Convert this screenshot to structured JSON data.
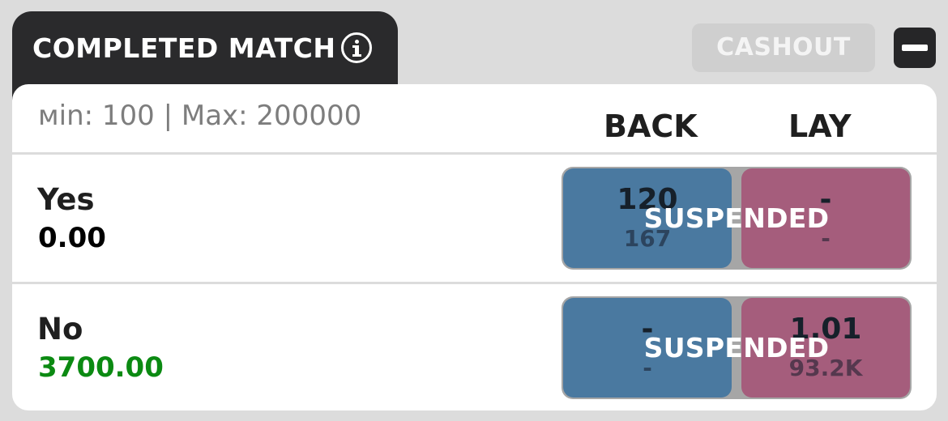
{
  "market": {
    "title": "COMPLETED MATCH",
    "info_icon": "info-icon",
    "cashout_label": "CASHOUT",
    "collapse_icon": "minus-icon",
    "limits": "мin: 100 | Max: 200000",
    "back_header": "BACK",
    "lay_header": "LAY"
  },
  "runners": [
    {
      "name": "Yes",
      "pl": "0.00",
      "back_price": "120",
      "back_size": "167",
      "lay_price": "-",
      "lay_size": "-",
      "status": "SUSPENDED"
    },
    {
      "name": "No",
      "pl": "3700.00",
      "back_price": "-",
      "back_size": "-",
      "lay_price": "1.01",
      "lay_size": "93.2K",
      "status": "SUSPENDED"
    }
  ],
  "colors": {
    "back": "#4a79a0",
    "lay": "#a55d7c",
    "positive": "#0b8a12",
    "header_bg": "#2a2a2c"
  }
}
